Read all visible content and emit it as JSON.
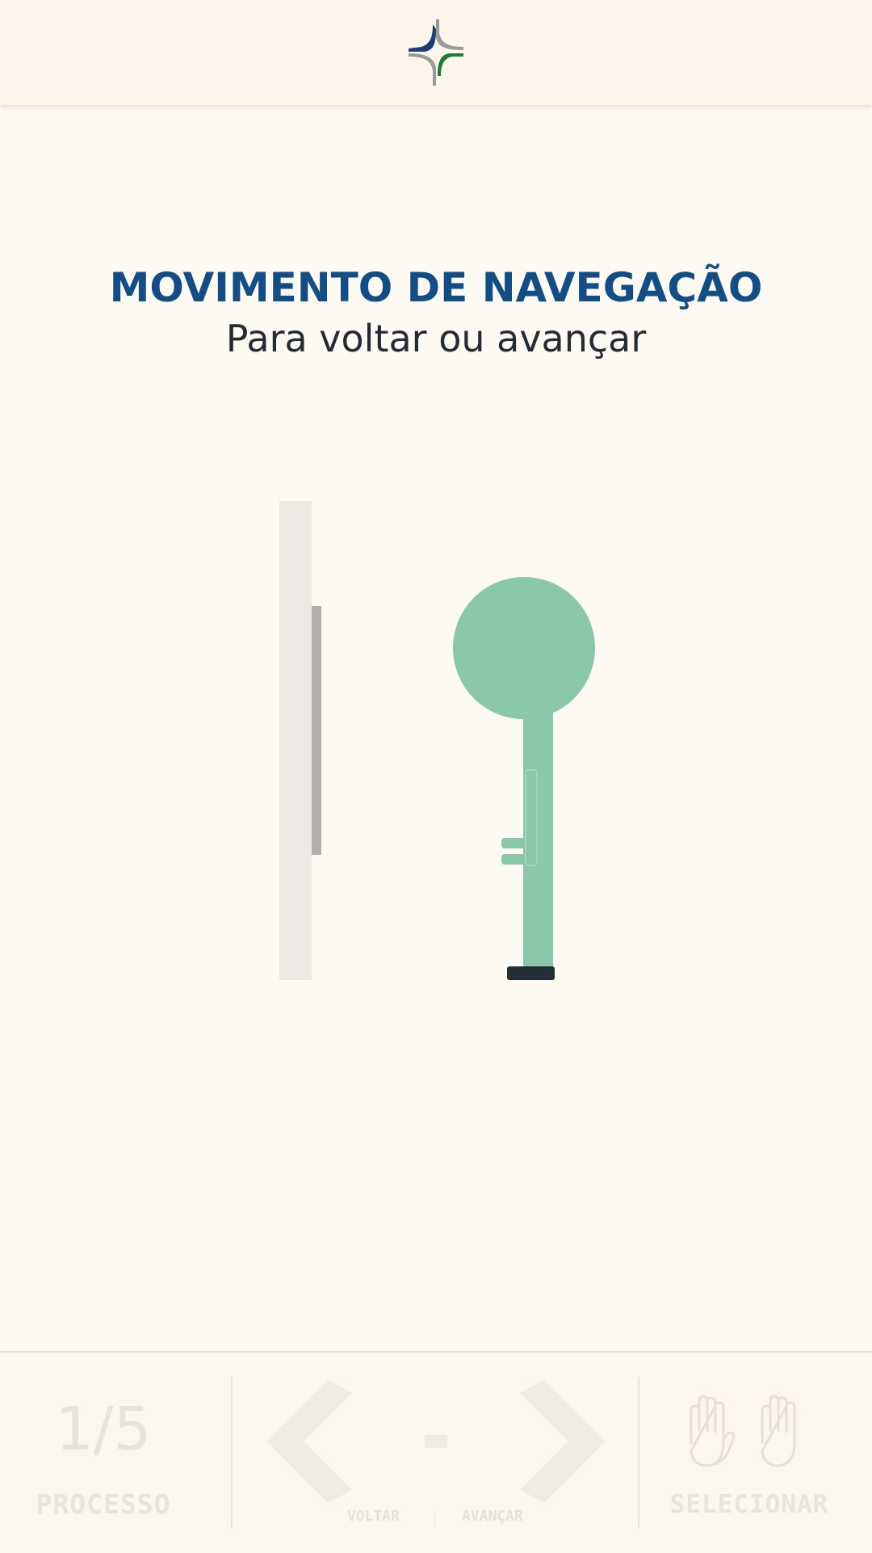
{
  "header": {
    "logo_icon": "institution-logo-icon"
  },
  "main": {
    "title": "MOVIMENTO DE NAVEGAÇÃO",
    "subtitle": "Para voltar ou avançar",
    "illustration_icons": [
      "sensor-panel-icon",
      "hand-pointer-icon"
    ],
    "colors": {
      "title": "#124d86",
      "hand": "#8ac7ab",
      "panel": "#ece9e4"
    }
  },
  "footer": {
    "progress": {
      "count": "1/5",
      "label": "PROCESSO"
    },
    "navigation": {
      "back_label": "VOLTAR",
      "forward_label": "AVANÇAR",
      "separator": "-",
      "icons": [
        "chevron-left-icon",
        "chevron-right-icon"
      ]
    },
    "select": {
      "label": "SELECIONAR",
      "icons": [
        "open-hand-left-icon",
        "open-hand-right-icon"
      ]
    }
  }
}
